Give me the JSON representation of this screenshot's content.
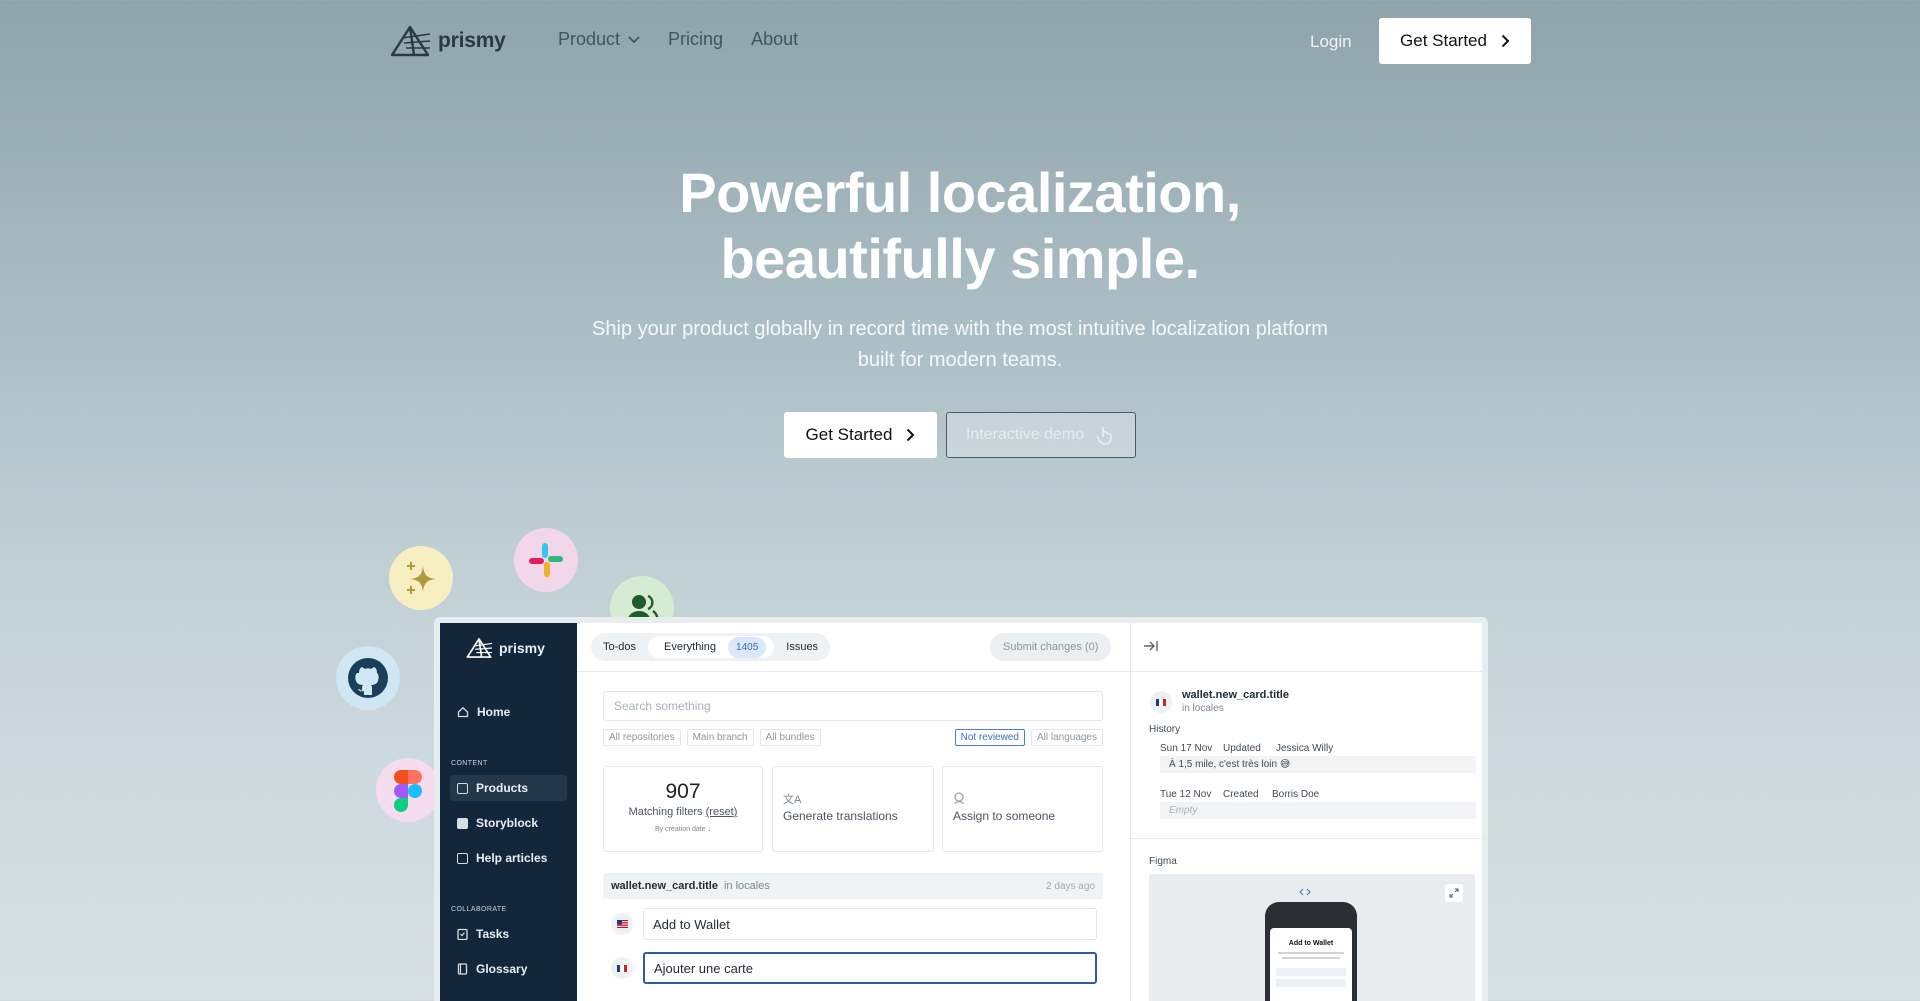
{
  "brand": {
    "name": "prismy"
  },
  "nav": {
    "links": [
      "Product",
      "Pricing",
      "About"
    ],
    "login": "Login",
    "cta": "Get Started"
  },
  "hero": {
    "title_line1": "Powerful localization,",
    "title_line2": "beautifully simple.",
    "subtitle_line1": "Ship your product globally in record time with the most intuitive localization platform",
    "subtitle_line2": "built for modern teams.",
    "cta": "Get Started",
    "demo": "Interactive demo"
  },
  "integrations": [
    "sparkle-icon",
    "slack-icon",
    "users-icon",
    "github-icon",
    "figma-icon"
  ],
  "app": {
    "brand": "prismy",
    "sidebar": {
      "home": "Home",
      "content_section": "CONTENT",
      "content_items": [
        "Products",
        "Storyblock",
        "Help articles"
      ],
      "collab_section": "COLLABORATE",
      "collab_items": [
        "Tasks",
        "Glossary"
      ]
    },
    "tabs": {
      "todos": "To-dos",
      "everything": "Everything",
      "count": "1405",
      "issues": "Issues"
    },
    "submit": "Submit changes (0)",
    "search_placeholder": "Search something",
    "filters": [
      "All repositories",
      "Main branch",
      "All bundles"
    ],
    "filter_selected": "Not reviewed",
    "filter_lang": "All languages",
    "stats": {
      "count": "907",
      "label": "Matching filters",
      "reset": "(reset)",
      "sort": "By creation date ↓"
    },
    "actions": {
      "generate": "Generate translations",
      "assign": "Assign to someone"
    },
    "entry": {
      "key": "wallet.new_card.title",
      "scope": "in locales",
      "time": "2 days ago",
      "en": "Add to Wallet",
      "fr": "Ajouter une carte"
    },
    "detail": {
      "key": "wallet.new_card.title",
      "scope": "in locales",
      "history_label": "History",
      "h1_date": "Sun 17 Nov",
      "h1_action": "Updated",
      "h1_user": "Jessica Willy",
      "h1_text": "À 1,5 mile, c'est très loin 😅",
      "h2_date": "Tue 12 Nov",
      "h2_action": "Created",
      "h2_user": "Borris Doe",
      "h2_text": "Empty",
      "figma_label": "Figma",
      "phone_title": "Add to Wallet"
    }
  }
}
